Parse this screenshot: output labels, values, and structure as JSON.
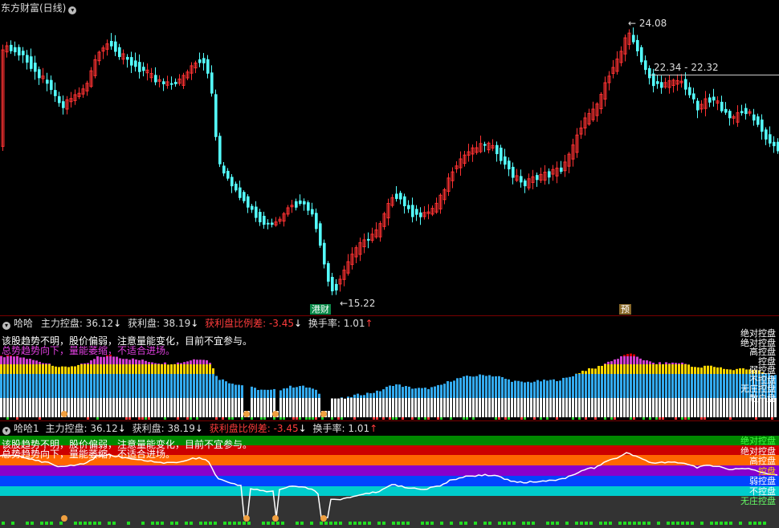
{
  "title": "东方财富(日线)",
  "price_labels": {
    "high": "24.08",
    "range": "22.34 - 22.32",
    "low": "15.22"
  },
  "badges": {
    "left": "港财",
    "right": "预"
  },
  "indicator1": {
    "name": "哈哈",
    "main_control_label": "主力控盘:",
    "main_control_value": "36.12",
    "main_control_arrow": "↓",
    "profit_label": "获利盘:",
    "profit_value": "38.19",
    "profit_arrow": "↓",
    "ratio_label": "获利盘比例差:",
    "ratio_value": "-3.45",
    "ratio_arrow": "↓",
    "turnover_label": "换手率:",
    "turnover_value": "1.01",
    "turnover_arrow": "↑",
    "comment1": "该股趋势不明，股价偏弱，注意量能变化，目前不宜参与。",
    "comment2": "总势趋势向下，量能萎缩，不适合进场。",
    "levels": [
      "绝对控盘",
      "绝对控盘",
      "高控盘",
      "控盘",
      "弱控盘",
      "不控盘",
      "无庄控盘",
      "散户盘"
    ]
  },
  "indicator2": {
    "name": "哈哈1",
    "main_control_label": "主力控盘:",
    "main_control_value": "36.12",
    "main_control_arrow": "↓",
    "profit_label": "获利盘:",
    "profit_value": "38.19",
    "profit_arrow": "↓",
    "ratio_label": "获利盘比例差:",
    "ratio_value": "-3.45",
    "ratio_arrow": "↓",
    "turnover_label": "换手率:",
    "turnover_value": "1.01",
    "turnover_arrow": "↑",
    "comment1": "该股趋势不明，股价偏弱，注意量能变化，目前不宜参与。",
    "comment2": "总势趋势向下，量能萎缩，不适合进场。",
    "levels": [
      "绝对控盘",
      "绝对控盘",
      "高控盘",
      "控盘",
      "弱控盘",
      "不控盘",
      "无庄控盘"
    ]
  },
  "colors": {
    "up": "#ff3232",
    "down": "#54ffff",
    "label_red": "#ff3c3c",
    "label_gold": "#ffd700",
    "comment_white": "#ffffff",
    "comment_purple": "#e040e0"
  }
}
